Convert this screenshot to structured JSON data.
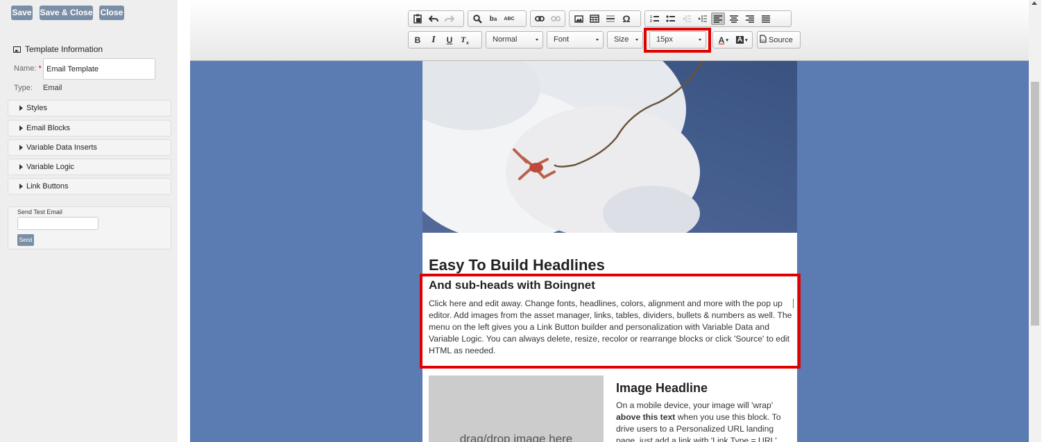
{
  "top_buttons": {
    "save": "Save",
    "save_close": "Save & Close",
    "close": "Close"
  },
  "template_info": {
    "title": "Template Information",
    "name_label": "Name:",
    "required_mark": "*",
    "name_value": "Email Template",
    "type_label": "Type:",
    "type_value": "Email"
  },
  "accordion": [
    "Styles",
    "Email Blocks",
    "Variable Data Inserts",
    "Variable Logic",
    "Link Buttons"
  ],
  "send_test": {
    "label": "Send Test Email",
    "button": "Send"
  },
  "toolbar": {
    "format": "Normal",
    "font": "Font",
    "size": "Size",
    "font_size_value": "15px",
    "source": "Source",
    "bold": "B",
    "italic": "I",
    "underline": "U",
    "omega": "Ω",
    "text_color": "A",
    "bg_color": "A",
    "spellcheck": "ABC"
  },
  "email": {
    "headline": "Easy To Build Headlines",
    "subhead": "And sub-heads with Boingnet",
    "paragraph": "Click here and edit away. Change fonts, headlines, colors, alignment and more with the pop up editor. Add images from the asset manager, links, tables, dividers, bullets & numbers as well. The menu on the left gives you a Link Button builder and personalization with Variable Data and Variable Logic. You can always delete, resize, recolor or rearrange blocks or click 'Source' to edit HTML as needed.",
    "image_placeholder": "drag/drop image here",
    "image_headline": "Image Headline",
    "image_text_1": "On a mobile device, your image will 'wrap'",
    "image_text_bold": "above this text",
    "image_text_2": "when you use this block. To drive users to a Personalized URL landing page, just add a link with 'Link Type = URL'"
  },
  "colors": {
    "editor_bg": "#5b7bb3",
    "button_bg": "#7a8fa6",
    "highlight": "#e00000"
  }
}
